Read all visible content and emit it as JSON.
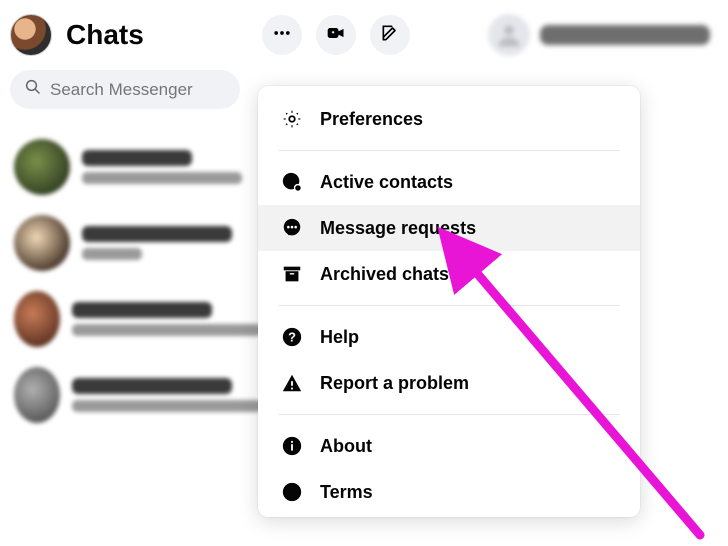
{
  "header": {
    "title": "Chats"
  },
  "search": {
    "placeholder": "Search Messenger"
  },
  "menu": {
    "preferences": "Preferences",
    "active_contacts": "Active contacts",
    "message_requests": "Message requests",
    "archived_chats": "Archived chats",
    "help": "Help",
    "report_problem": "Report a problem",
    "about": "About",
    "terms": "Terms"
  }
}
